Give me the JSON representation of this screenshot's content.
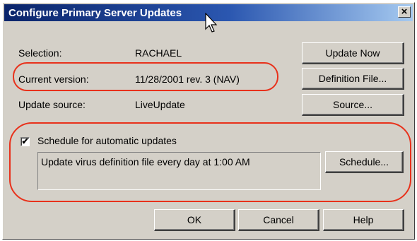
{
  "window": {
    "title": "Configure Primary Server Updates",
    "close_label": "×"
  },
  "fields": {
    "selection_label": "Selection:",
    "selection_value": "RACHAEL",
    "version_label": "Current version:",
    "version_value": "11/28/2001 rev. 3 (NAV)",
    "source_label": "Update source:",
    "source_value": "LiveUpdate"
  },
  "buttons": {
    "update_now": "Update Now",
    "definition_file": "Definition File...",
    "source": "Source...",
    "schedule": "Schedule...",
    "ok": "OK",
    "cancel": "Cancel",
    "help": "Help"
  },
  "schedule": {
    "checkbox_label": "Schedule for automatic updates",
    "checked": true,
    "description": "Update virus definition file every day at 1:00 AM"
  },
  "colors": {
    "highlight_ring": "#e8311b",
    "titlebar": "#0a246a"
  }
}
